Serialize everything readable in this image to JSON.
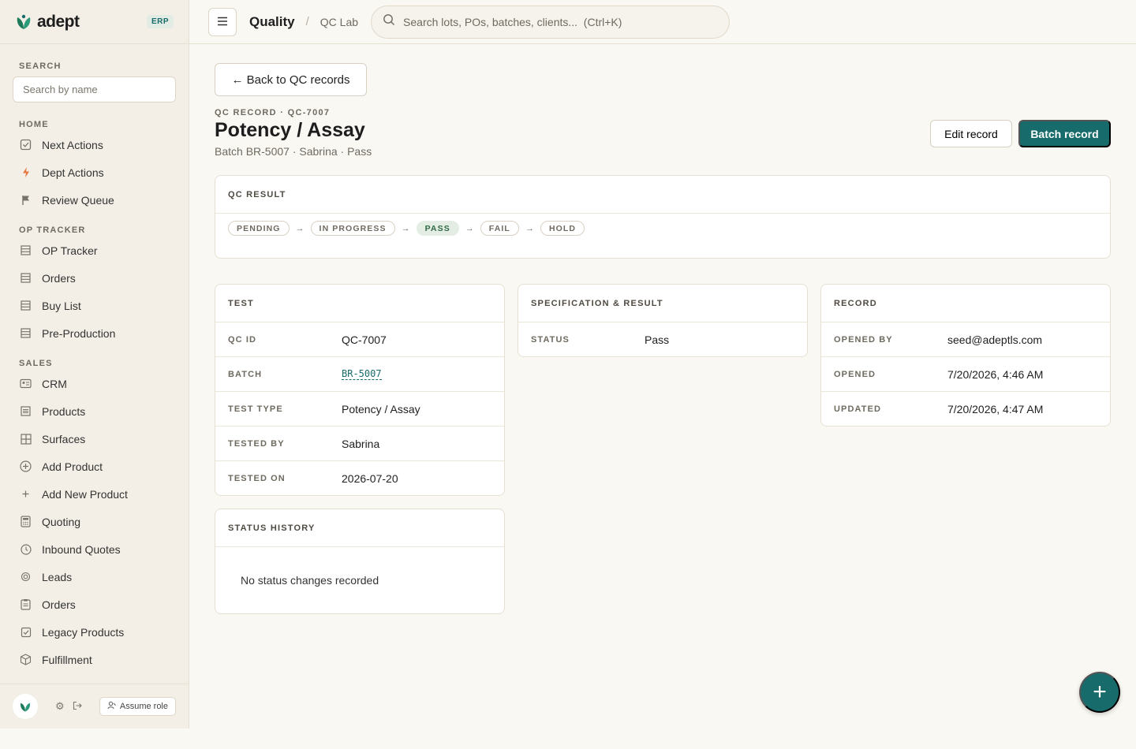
{
  "brand": {
    "name": "adept",
    "tag": "ERP",
    "accent": "#176b6a"
  },
  "sidebar": {
    "search_heading": "SEARCH",
    "search_placeholder": "Search by name",
    "sections": [
      {
        "heading": "HOME",
        "items": [
          {
            "label": "Next Actions",
            "icon": "checkbox-icon"
          },
          {
            "label": "Dept Actions",
            "icon": "bolt-icon"
          },
          {
            "label": "Review Queue",
            "icon": "flag-icon"
          }
        ]
      },
      {
        "heading": "OP TRACKER",
        "items": [
          {
            "label": "OP Tracker",
            "icon": "grid-icon"
          },
          {
            "label": "Orders",
            "icon": "grid-icon"
          },
          {
            "label": "Buy List",
            "icon": "grid-icon"
          },
          {
            "label": "Pre-Production",
            "icon": "grid-icon"
          }
        ]
      },
      {
        "heading": "SALES",
        "items": [
          {
            "label": "CRM",
            "icon": "contact-card-icon"
          },
          {
            "label": "Products",
            "icon": "list-icon"
          },
          {
            "label": "Surfaces",
            "icon": "table-icon"
          },
          {
            "label": "Add Product",
            "icon": "plus-circle-icon"
          },
          {
            "label": "Add New Product",
            "icon": "plus-icon"
          },
          {
            "label": "Quoting",
            "icon": "calculator-icon"
          },
          {
            "label": "Inbound Quotes",
            "icon": "clock-icon"
          },
          {
            "label": "Leads",
            "icon": "target-icon"
          },
          {
            "label": "Orders",
            "icon": "clipboard-icon"
          },
          {
            "label": "Legacy Products",
            "icon": "checkbox-icon"
          },
          {
            "label": "Fulfillment",
            "icon": "box-icon"
          }
        ]
      }
    ],
    "footer": {
      "assume_role_label": "Assume role"
    }
  },
  "topbar": {
    "crumb_primary": "Quality",
    "crumb_separator": "/",
    "crumb_secondary": "QC Lab",
    "search_placeholder": "Search lots, POs, batches, clients...  (Ctrl+K)"
  },
  "page": {
    "back_label": "← Back to QC records",
    "eyebrow": "QC RECORD · QC-7007",
    "title": "Potency / Assay",
    "subtitle": "Batch BR-5007 · Sabrina · Pass",
    "edit_label": "Edit record",
    "batch_label": "Batch record"
  },
  "qc_result": {
    "heading": "QC RESULT",
    "steps": [
      {
        "label": "PENDING",
        "active": false
      },
      {
        "label": "IN PROGRESS",
        "active": false
      },
      {
        "label": "PASS",
        "active": true
      },
      {
        "label": "FAIL",
        "active": false
      },
      {
        "label": "HOLD",
        "active": false
      }
    ],
    "arrow": "→"
  },
  "test_card": {
    "heading": "TEST",
    "rows": [
      {
        "key": "QC ID",
        "value": "QC-7007"
      },
      {
        "key": "BATCH",
        "value": "BR-5007",
        "link": true
      },
      {
        "key": "TEST TYPE",
        "value": "Potency / Assay"
      },
      {
        "key": "TESTED BY",
        "value": "Sabrina"
      },
      {
        "key": "TESTED ON",
        "value": "2026-07-20"
      }
    ]
  },
  "spec_card": {
    "heading": "SPECIFICATION & RESULT",
    "rows": [
      {
        "key": "STATUS",
        "value": "Pass"
      }
    ]
  },
  "record_card": {
    "heading": "RECORD",
    "rows": [
      {
        "key": "OPENED BY",
        "value": "seed@adeptls.com"
      },
      {
        "key": "OPENED",
        "value": "7/20/2026, 4:46 AM"
      },
      {
        "key": "UPDATED",
        "value": "7/20/2026, 4:47 AM"
      }
    ]
  },
  "history_card": {
    "heading": "STATUS HISTORY",
    "empty_text": "No status changes recorded"
  },
  "fab_label": "+"
}
